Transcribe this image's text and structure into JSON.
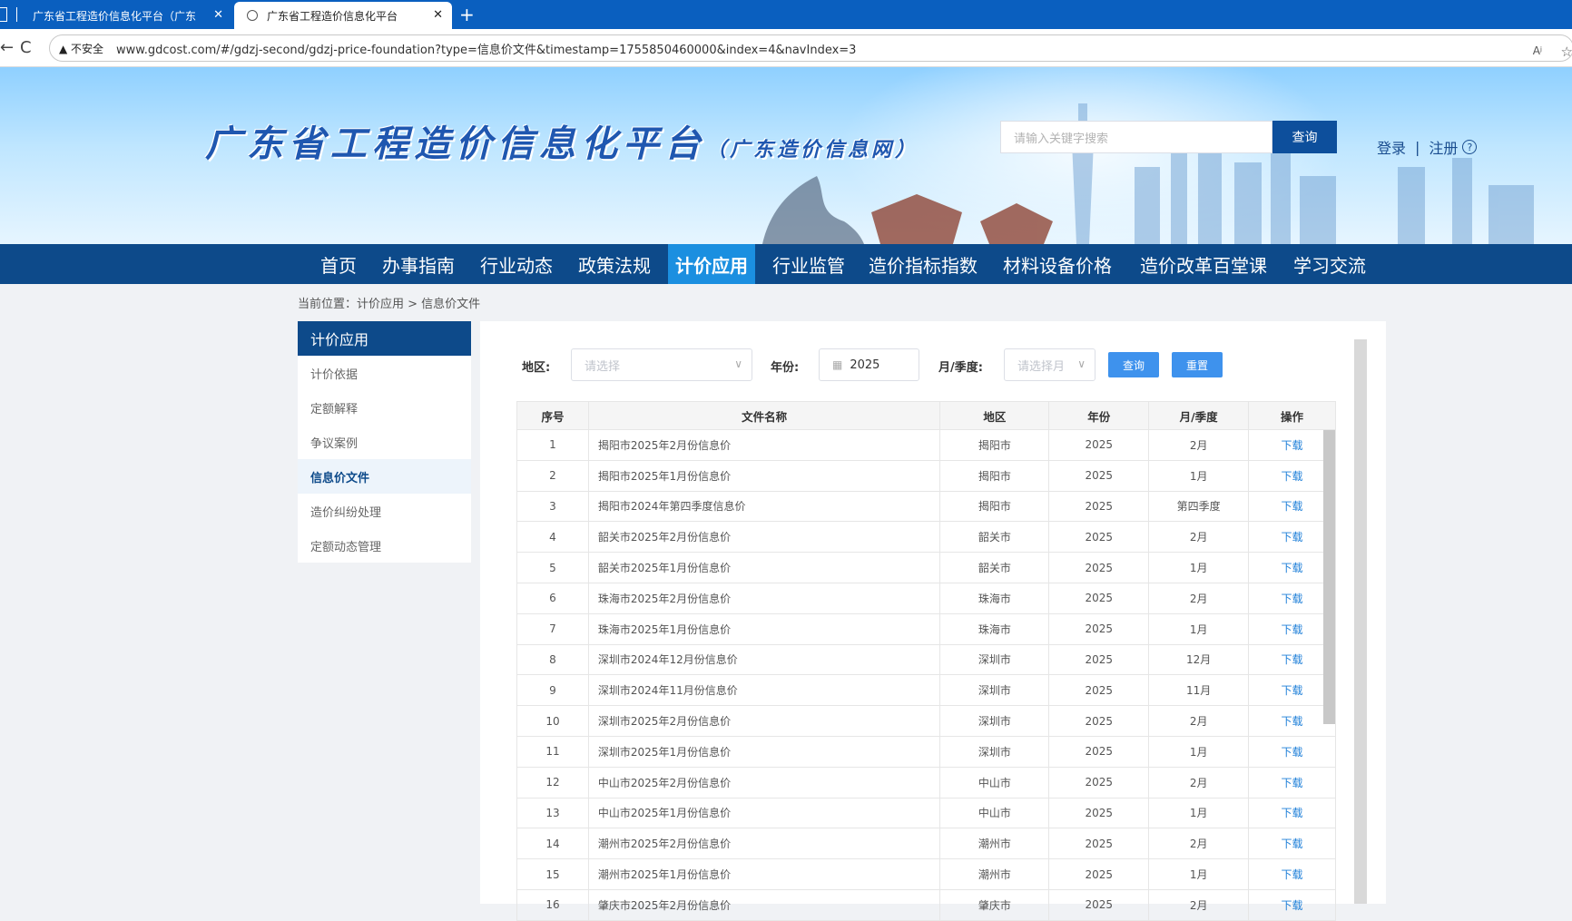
{
  "browser": {
    "tabs": [
      {
        "label": "广东省工程造价信息化平台（广东",
        "close": "✕"
      },
      {
        "label": "广东省工程造价信息化平台",
        "close": "✕"
      }
    ],
    "new_tab": "+",
    "reload": "C",
    "security": "▲ 不安全",
    "url": "www.gdcost.com/#/gdzj-second/gdzj-price-foundation?type=信息价文件&timestamp=1755850460000&index=4&navIndex=3",
    "read_aloud": "Aʲ",
    "favorite": "☆"
  },
  "header": {
    "title": "广东省工程造价信息化平台",
    "subtitle": "（广东造价信息网）",
    "search_placeholder": "请输入关键字搜索",
    "search_button": "查询",
    "login": "登录",
    "separator": "|",
    "register": "注册",
    "help": "?"
  },
  "nav": [
    "首页",
    "办事指南",
    "行业动态",
    "政策法规",
    "计价应用",
    "行业监管",
    "造价指标指数",
    "材料设备价格",
    "造价改革百堂课",
    "学习交流"
  ],
  "breadcrumb": "当前位置：计价应用 > 信息价文件",
  "sidebar": {
    "title": "计价应用",
    "items": [
      "计价依据",
      "定额解释",
      "争议案例",
      "信息价文件",
      "造价纠纷处理",
      "定额动态管理"
    ]
  },
  "filters": {
    "region_label": "地区:",
    "region_placeholder": "请选择",
    "year_label": "年份:",
    "year_value": "2025",
    "month_label": "月/季度:",
    "month_placeholder": "请选择月",
    "query_button": "查询",
    "reset_button": "重置"
  },
  "table": {
    "headers": [
      "序号",
      "文件名称",
      "地区",
      "年份",
      "月/季度",
      "操作"
    ],
    "rows": [
      [
        "1",
        "揭阳市2025年2月份信息价",
        "揭阳市",
        "2025",
        "2月",
        "下载"
      ],
      [
        "2",
        "揭阳市2025年1月份信息价",
        "揭阳市",
        "2025",
        "1月",
        "下载"
      ],
      [
        "3",
        "揭阳市2024年第四季度信息价",
        "揭阳市",
        "2025",
        "第四季度",
        "下载"
      ],
      [
        "4",
        "韶关市2025年2月份信息价",
        "韶关市",
        "2025",
        "2月",
        "下载"
      ],
      [
        "5",
        "韶关市2025年1月份信息价",
        "韶关市",
        "2025",
        "1月",
        "下载"
      ],
      [
        "6",
        "珠海市2025年2月份信息价",
        "珠海市",
        "2025",
        "2月",
        "下载"
      ],
      [
        "7",
        "珠海市2025年1月份信息价",
        "珠海市",
        "2025",
        "1月",
        "下载"
      ],
      [
        "8",
        "深圳市2024年12月份信息价",
        "深圳市",
        "2025",
        "12月",
        "下载"
      ],
      [
        "9",
        "深圳市2024年11月份信息价",
        "深圳市",
        "2025",
        "11月",
        "下载"
      ],
      [
        "10",
        "深圳市2025年2月份信息价",
        "深圳市",
        "2025",
        "2月",
        "下载"
      ],
      [
        "11",
        "深圳市2025年1月份信息价",
        "深圳市",
        "2025",
        "1月",
        "下载"
      ],
      [
        "12",
        "中山市2025年2月份信息价",
        "中山市",
        "2025",
        "2月",
        "下载"
      ],
      [
        "13",
        "中山市2025年1月份信息价",
        "中山市",
        "2025",
        "1月",
        "下载"
      ],
      [
        "14",
        "潮州市2025年2月份信息价",
        "潮州市",
        "2025",
        "2月",
        "下载"
      ],
      [
        "15",
        "潮州市2025年1月份信息价",
        "潮州市",
        "2025",
        "1月",
        "下载"
      ],
      [
        "16",
        "肇庆市2025年2月份信息价",
        "肇庆市",
        "2025",
        "2月",
        "下载"
      ]
    ]
  }
}
